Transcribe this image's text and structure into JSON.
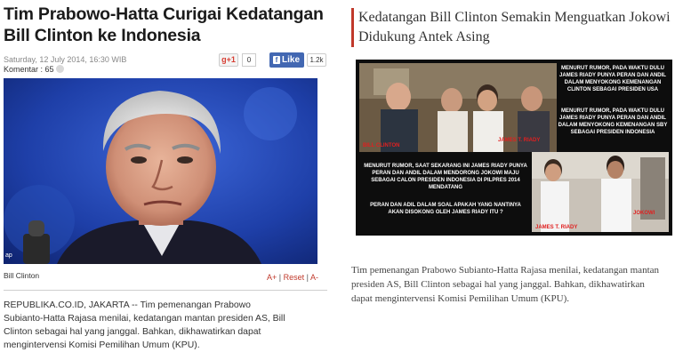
{
  "left": {
    "headline": "Tim Prabowo-Hatta Curigai Kedatangan Bill Clinton ke Indonesia",
    "date": "Saturday, 12 July 2014, 16:30 WIB",
    "comments": "Komentar : 65",
    "gplus_label": "g+1",
    "gplus_count": "0",
    "fb_label": "Like",
    "fb_count": "1.2k",
    "photo_watermark": "ap",
    "caption": "Bill Clinton",
    "font_plus": "A+",
    "font_reset": "Reset",
    "font_minus": "A-",
    "body": "REPUBLIKA.CO.ID, JAKARTA -- Tim pemenangan Prabowo Subianto-Hatta Rajasa menilai, kedatangan mantan presiden AS, Bill Clinton sebagai hal yang janggal. Bahkan, dikhawatirkan dapat mengintervensi Komisi Pemilihan Umum (KPU)."
  },
  "right": {
    "headline": "Kedatangan Bill Clinton Semakin Menguatkan Jokowi Didukung Antek Asing",
    "collage": {
      "caption1": "MENURUT RUMOR, PADA WAKTU DULU JAMES RIADY PUNYA PERAN DAN ANDIL DALAM MENYOKONG KEMENANGAN CLINTON SEBAGAI PRESIDEN USA",
      "caption2": "MENURUT RUMOR, PADA WAKTU DULU JAMES RIADY PUNYA PERAN DAN ANDIL DALAM MENYOKONG KEMENANGAN SBY SEBAGAI PRESIDEN INDONESIA",
      "caption3": "MENURUT RUMOR, SAAT SEKARANG INI JAMES RIADY PUNYA PERAN DAN ANDIL DALAM MENDORONG JOKOWI MAJU SEBAGAI CALON PRESIDEN INDONESIA DI PILPRES 2014 MENDATANG",
      "caption4": "PERAN DAN ADIL DALAM SOAL APAKAH YANG NANTINYA AKAN DISOKONG OLEH JAMES RIADY ITU ?",
      "label_clinton": "BILL CLINTON",
      "label_riady_top": "JAMES T. RIADY",
      "label_riady_bottom": "JAMES T. RIADY",
      "label_jokowi": "JOKOWI"
    },
    "body": "Tim pemenangan Prabowo Subianto-Hatta Rajasa menilai, kedatangan mantan presiden AS, Bill Clinton sebagai hal yang janggal. Bahkan, dikhawatirkan dapat mengintervensi Komisi Pemilihan Umum (KPU)."
  },
  "colors": {
    "accent_red": "#c0392b",
    "facebook_blue": "#4267b2",
    "photo_bg": "#1a3c9a",
    "collage_bg": "#0d0d0d",
    "label_red": "#e02020"
  }
}
